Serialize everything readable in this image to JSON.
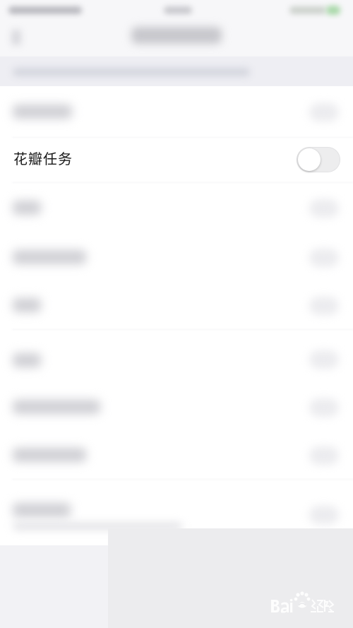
{
  "focused_row": {
    "label": "花瓣任务",
    "toggle_on": false
  },
  "watermark": {
    "logo": "baidu-jingyan-logo"
  },
  "colors": {
    "page_background": "#f6f6f8",
    "list_background": "#ffffff",
    "toggle_off_track": "#ededee",
    "toggle_knob": "#ffffff",
    "text_primary": "#1a1a1a"
  }
}
